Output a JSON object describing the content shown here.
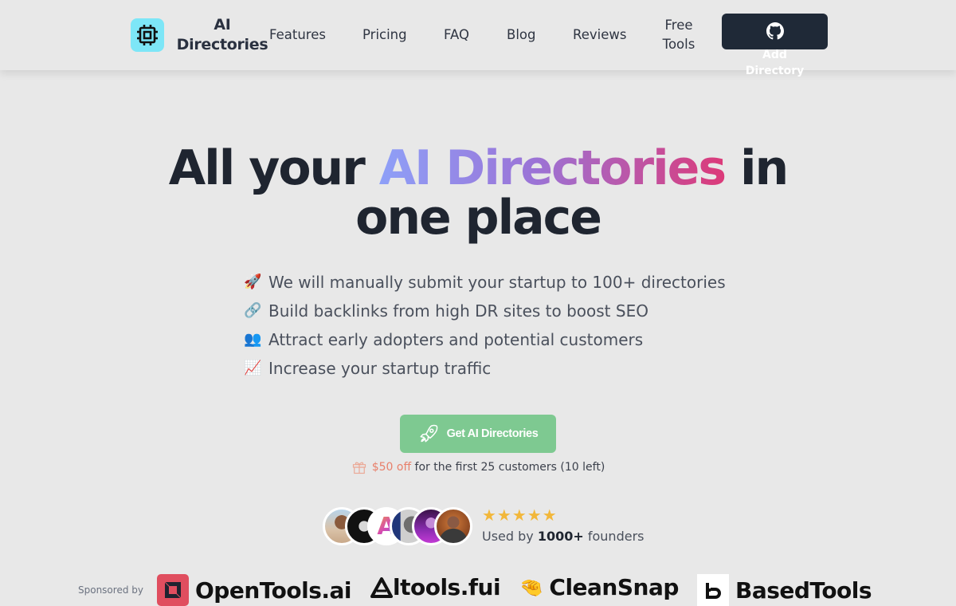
{
  "header": {
    "logo_text_line1": "AI",
    "logo_text_line2": "Directories",
    "logo_icon": "cpu-chip-icon",
    "nav": [
      {
        "label": "Features"
      },
      {
        "label": "Pricing"
      },
      {
        "label": "FAQ"
      },
      {
        "label": "Blog"
      },
      {
        "label": "Reviews"
      },
      {
        "label_line1": "Free",
        "label_line2": "Tools"
      }
    ],
    "add_button": {
      "icon": "github-icon",
      "label_line1": "Add",
      "label_line2": "Directory"
    }
  },
  "hero": {
    "title_part1": "All your ",
    "title_highlight": "AI Directories",
    "title_part2": " in",
    "title_line2": "one place",
    "gradient_colors": [
      "#8ea0f8",
      "#9b73d6",
      "#dc3a79"
    ],
    "features": [
      {
        "emoji": "🚀",
        "icon": "rocket-icon",
        "text": "We will manually submit your startup to 100+ directories"
      },
      {
        "emoji": "🔗",
        "icon": "link-icon",
        "text": "Build backlinks from high DR sites to boost SEO"
      },
      {
        "emoji": "👥",
        "icon": "people-icon",
        "text": "Attract early adopters and potential customers"
      },
      {
        "emoji": "📈",
        "icon": "chart-up-icon",
        "text": "Increase your startup traffic"
      }
    ],
    "cta": {
      "label": "Get AI Directories",
      "icon": "rocket-outline-icon",
      "color": "#7ec991"
    },
    "promo": {
      "icon": "gift-icon",
      "highlight": "$50 off",
      "text": "for the first 25 customers (10 left)"
    }
  },
  "social_proof": {
    "avatar_count": 6,
    "rating_stars": 5,
    "stars_text": "★★★★★",
    "used_by_prefix": "Used by ",
    "used_by_count": "1000+",
    "used_by_suffix": " founders"
  },
  "sponsors": {
    "label": "Sponsored by",
    "items": [
      {
        "name": "OpenTools.ai"
      },
      {
        "name": "Aitools.fyi",
        "display": "ltools.fui"
      },
      {
        "name": "CleanSnap",
        "emoji": "🤏"
      },
      {
        "name": "BasedTools"
      }
    ]
  }
}
